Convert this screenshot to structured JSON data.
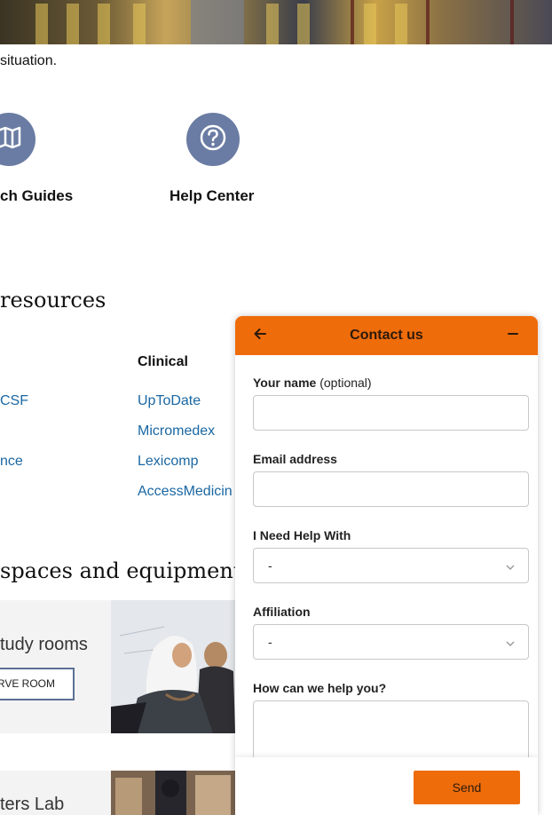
{
  "intro": {
    "text": "situation."
  },
  "quick_links": [
    {
      "label": "ch Guides",
      "icon": "map-icon"
    },
    {
      "label": "Help Center",
      "icon": "question-circle-icon"
    }
  ],
  "resources": {
    "heading": "resources",
    "clinical_heading": "Clinical",
    "left_links": [
      "CSF",
      "nce"
    ],
    "clinical_links": [
      "UpToDate",
      "Micromedex",
      "Lexicomp",
      "AccessMedicin"
    ]
  },
  "spaces": {
    "heading": "spaces and equipment",
    "card1_title": "tudy rooms",
    "card1_button": "RVE ROOM",
    "card2_title": "ters Lab"
  },
  "contact_widget": {
    "title": "Contact us",
    "back_icon": "arrow-left-icon",
    "minimize_icon": "minimize-icon",
    "name_label": "Your name",
    "name_optional": "(optional)",
    "name_value": "",
    "email_label": "Email address",
    "email_value": "",
    "help_label": "I Need Help With",
    "help_selected": "-",
    "affiliation_label": "Affiliation",
    "affiliation_selected": "-",
    "message_label": "How can we help you?",
    "send_label": "Send",
    "accent_color": "#ef6c0b",
    "link_color": "#1a67a3",
    "icon_circle_color": "#6a7ca3"
  }
}
